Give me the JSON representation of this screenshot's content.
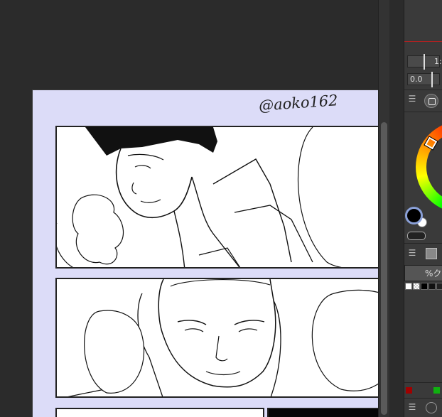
{
  "canvas": {
    "signature": "@aoko162"
  },
  "right_panel": {
    "slider_top_value": "1:",
    "slider_bottom_value": "0.0",
    "tab_label": "%ク",
    "main_color": "#000000",
    "sub_color": "#ffffff",
    "marker_red": "#a00000",
    "marker_green": "#10b010"
  },
  "icons": {
    "panel_menu": "hamburger-icon",
    "color_circle": "color-circle-icon",
    "palette": "palette-icon",
    "swap": "swap-colors-icon"
  }
}
